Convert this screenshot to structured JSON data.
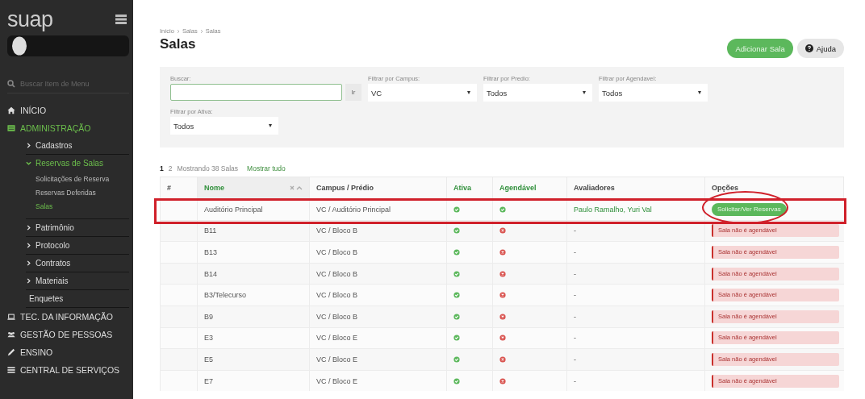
{
  "sidebar": {
    "logo": "suap",
    "search_placeholder": "Buscar Item de Menu",
    "items": [
      {
        "label": "INÍCIO",
        "expanded": false
      },
      {
        "label": "ADMINISTRAÇÃO",
        "expanded": true,
        "children": [
          {
            "label": "Cadastros",
            "expanded": false
          },
          {
            "label": "Reservas de Salas",
            "expanded": true,
            "children": [
              {
                "label": "Solicitações de Reserva",
                "selected": false
              },
              {
                "label": "Reservas Deferidas",
                "selected": false
              },
              {
                "label": "Salas",
                "selected": true
              }
            ]
          },
          {
            "label": "Patrimônio",
            "expanded": false
          },
          {
            "label": "Protocolo",
            "expanded": false
          },
          {
            "label": "Contratos",
            "expanded": false
          },
          {
            "label": "Materiais",
            "expanded": false
          },
          {
            "label": "Enquetes"
          }
        ]
      },
      {
        "label": "TEC. DA INFORMAÇÃO",
        "expanded": false
      },
      {
        "label": "GESTÃO DE PESSOAS",
        "expanded": false
      },
      {
        "label": "ENSINO",
        "expanded": false
      },
      {
        "label": "CENTRAL DE SERVIÇOS",
        "expanded": false
      }
    ]
  },
  "breadcrumb": [
    "Início",
    "Salas",
    "Salas"
  ],
  "title": "Salas",
  "actions": [
    {
      "label": "Adicionar Sala",
      "kind": "primary"
    },
    {
      "label": "Ajuda",
      "kind": "help"
    }
  ],
  "filters": {
    "search": {
      "label": "Buscar:",
      "button": "Ir"
    },
    "selects": [
      {
        "label": "Filtrar por Campus:",
        "value": "VC"
      },
      {
        "label": "Filtrar por Predio:",
        "value": "Todos"
      },
      {
        "label": "Filtrar por Agendavel:",
        "value": "Todos"
      },
      {
        "label": "Filtrar por Ativa:",
        "value": "Todos"
      }
    ]
  },
  "pagination": {
    "pages": [
      {
        "label": "1",
        "selected": true
      },
      {
        "label": "2",
        "selected": false
      }
    ],
    "summary": "Mostrando 38 Salas",
    "show_all": "Mostrar tudo"
  },
  "table": {
    "columns": [
      {
        "label": "#",
        "sortable": false
      },
      {
        "label": "Nome",
        "sortable": true,
        "sorted": true
      },
      {
        "label": "Campus / Prédio",
        "sortable": false
      },
      {
        "label": "Ativa",
        "sortable": true
      },
      {
        "label": "Agendável",
        "sortable": true
      },
      {
        "label": "Avaliadores",
        "sortable": false
      },
      {
        "label": "Opções",
        "sortable": false
      }
    ],
    "rows": [
      {
        "name": "Auditório Principal",
        "campus": "VC / Auditório Principal",
        "active": true,
        "schedulable": true,
        "reviewers": "Paulo Ramalho, Yuri Val",
        "option": {
          "kind": "button",
          "text": "Solicitar/Ver Reservas"
        }
      },
      {
        "name": "B11",
        "campus": "VC / Bloco B",
        "active": true,
        "schedulable": false,
        "reviewers": "-",
        "option": {
          "kind": "alert",
          "text": "Sala não é agendável"
        }
      },
      {
        "name": "B13",
        "campus": "VC / Bloco B",
        "active": true,
        "schedulable": false,
        "reviewers": "-",
        "option": {
          "kind": "alert",
          "text": "Sala não é agendável"
        }
      },
      {
        "name": "B14",
        "campus": "VC / Bloco B",
        "active": true,
        "schedulable": false,
        "reviewers": "-",
        "option": {
          "kind": "alert",
          "text": "Sala não é agendável"
        }
      },
      {
        "name": "B3/Telecurso",
        "campus": "VC / Bloco B",
        "active": true,
        "schedulable": false,
        "reviewers": "-",
        "option": {
          "kind": "alert",
          "text": "Sala não é agendável"
        }
      },
      {
        "name": "B9",
        "campus": "VC / Bloco B",
        "active": true,
        "schedulable": false,
        "reviewers": "-",
        "option": {
          "kind": "alert",
          "text": "Sala não é agendável"
        }
      },
      {
        "name": "E3",
        "campus": "VC / Bloco E",
        "active": true,
        "schedulable": false,
        "reviewers": "-",
        "option": {
          "kind": "alert",
          "text": "Sala não é agendável"
        }
      },
      {
        "name": "E5",
        "campus": "VC / Bloco E",
        "active": true,
        "schedulable": false,
        "reviewers": "-",
        "option": {
          "kind": "alert",
          "text": "Sala não é agendável"
        }
      },
      {
        "name": "E7",
        "campus": "VC / Bloco E",
        "active": true,
        "schedulable": false,
        "reviewers": "-",
        "option": {
          "kind": "alert",
          "text": "Sala não é agendável"
        }
      }
    ]
  },
  "highlight_rectangle": {
    "color": "#d0202a"
  },
  "highlight_ellipse": {
    "color": "#d0202a"
  }
}
